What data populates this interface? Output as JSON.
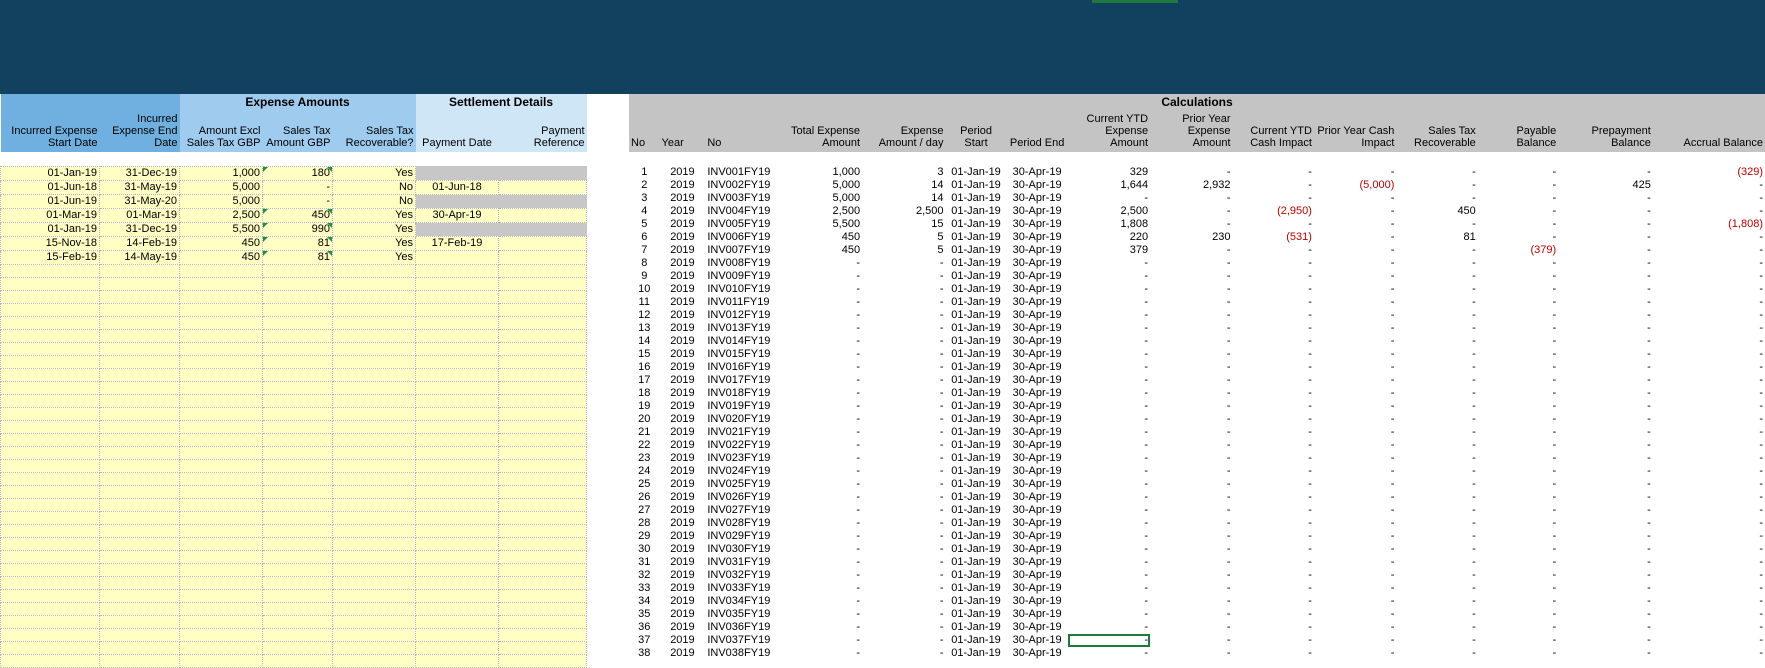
{
  "left_table": {
    "groups": {
      "expense_amounts": "Expense Amounts",
      "settlement_details": "Settlement Details"
    },
    "headers": [
      "Incurred Expense Start Date",
      "Incurred Expense End Date",
      "Amount Excl Sales Tax GBP",
      "Sales Tax Amount GBP",
      "Sales Tax Recoverable?",
      "Payment Date",
      "Payment Reference"
    ],
    "rows": [
      [
        "01-Jan-19",
        "31-Dec-19",
        "1,000",
        "180",
        "Yes",
        "",
        ""
      ],
      [
        "01-Jun-18",
        "31-May-19",
        "5,000",
        "-",
        "No",
        "01-Jun-18",
        ""
      ],
      [
        "01-Jun-19",
        "31-May-20",
        "5,000",
        "-",
        "No",
        "",
        ""
      ],
      [
        "01-Mar-19",
        "01-Mar-19",
        "2,500",
        "450",
        "Yes",
        "30-Apr-19",
        ""
      ],
      [
        "01-Jan-19",
        "31-Dec-19",
        "5,500",
        "990",
        "Yes",
        "",
        ""
      ],
      [
        "15-Nov-18",
        "14-Feb-19",
        "450",
        "81",
        "Yes",
        "17-Feb-19",
        ""
      ],
      [
        "15-Feb-19",
        "14-May-19",
        "450",
        "81",
        "Yes",
        "",
        ""
      ]
    ],
    "blank_rows": 31
  },
  "right_table": {
    "group": "Calculations",
    "headers": [
      "No",
      "Year",
      "No",
      "Total Expense Amount",
      "Expense Amount / day",
      "Period Start",
      "Period End",
      "Current YTD Expense Amount",
      "Prior Year Expense Amount",
      "Current YTD Cash Impact",
      "Prior Year Cash Impact",
      "Sales Tax Recoverable",
      "Payable Balance",
      "Prepayment Balance",
      "Accrual Balance"
    ],
    "rows": [
      [
        "1",
        "2019",
        "INV001FY19",
        "1,000",
        "3",
        "01-Jan-19",
        "30-Apr-19",
        "329",
        "-",
        "-",
        "-",
        "-",
        "-",
        "-",
        "(329)"
      ],
      [
        "2",
        "2019",
        "INV002FY19",
        "5,000",
        "14",
        "01-Jan-19",
        "30-Apr-19",
        "1,644",
        "2,932",
        "-",
        "(5,000)",
        "-",
        "-",
        "425",
        "-"
      ],
      [
        "3",
        "2019",
        "INV003FY19",
        "5,000",
        "14",
        "01-Jan-19",
        "30-Apr-19",
        "-",
        "-",
        "-",
        "-",
        "-",
        "-",
        "-",
        "-"
      ],
      [
        "4",
        "2019",
        "INV004FY19",
        "2,500",
        "2,500",
        "01-Jan-19",
        "30-Apr-19",
        "2,500",
        "-",
        "(2,950)",
        "-",
        "450",
        "-",
        "-",
        "-"
      ],
      [
        "5",
        "2019",
        "INV005FY19",
        "5,500",
        "15",
        "01-Jan-19",
        "30-Apr-19",
        "1,808",
        "-",
        "-",
        "-",
        "-",
        "-",
        "-",
        "(1,808)"
      ],
      [
        "6",
        "2019",
        "INV006FY19",
        "450",
        "5",
        "01-Jan-19",
        "30-Apr-19",
        "220",
        "230",
        "(531)",
        "-",
        "81",
        "-",
        "-",
        "-"
      ],
      [
        "7",
        "2019",
        "INV007FY19",
        "450",
        "5",
        "01-Jan-19",
        "30-Apr-19",
        "379",
        "-",
        "-",
        "-",
        "-",
        "(379)",
        "-",
        "-"
      ],
      [
        "8",
        "2019",
        "INV008FY19",
        "-",
        "-",
        "01-Jan-19",
        "30-Apr-19",
        "-",
        "-",
        "-",
        "-",
        "-",
        "-",
        "-",
        "-"
      ],
      [
        "9",
        "2019",
        "INV009FY19",
        "-",
        "-",
        "01-Jan-19",
        "30-Apr-19",
        "-",
        "-",
        "-",
        "-",
        "-",
        "-",
        "-",
        "-"
      ],
      [
        "10",
        "2019",
        "INV010FY19",
        "-",
        "-",
        "01-Jan-19",
        "30-Apr-19",
        "-",
        "-",
        "-",
        "-",
        "-",
        "-",
        "-",
        "-"
      ],
      [
        "11",
        "2019",
        "INV011FY19",
        "-",
        "-",
        "01-Jan-19",
        "30-Apr-19",
        "-",
        "-",
        "-",
        "-",
        "-",
        "-",
        "-",
        "-"
      ],
      [
        "12",
        "2019",
        "INV012FY19",
        "-",
        "-",
        "01-Jan-19",
        "30-Apr-19",
        "-",
        "-",
        "-",
        "-",
        "-",
        "-",
        "-",
        "-"
      ],
      [
        "13",
        "2019",
        "INV013FY19",
        "-",
        "-",
        "01-Jan-19",
        "30-Apr-19",
        "-",
        "-",
        "-",
        "-",
        "-",
        "-",
        "-",
        "-"
      ],
      [
        "14",
        "2019",
        "INV014FY19",
        "-",
        "-",
        "01-Jan-19",
        "30-Apr-19",
        "-",
        "-",
        "-",
        "-",
        "-",
        "-",
        "-",
        "-"
      ],
      [
        "15",
        "2019",
        "INV015FY19",
        "-",
        "-",
        "01-Jan-19",
        "30-Apr-19",
        "-",
        "-",
        "-",
        "-",
        "-",
        "-",
        "-",
        "-"
      ],
      [
        "16",
        "2019",
        "INV016FY19",
        "-",
        "-",
        "01-Jan-19",
        "30-Apr-19",
        "-",
        "-",
        "-",
        "-",
        "-",
        "-",
        "-",
        "-"
      ],
      [
        "17",
        "2019",
        "INV017FY19",
        "-",
        "-",
        "01-Jan-19",
        "30-Apr-19",
        "-",
        "-",
        "-",
        "-",
        "-",
        "-",
        "-",
        "-"
      ],
      [
        "18",
        "2019",
        "INV018FY19",
        "-",
        "-",
        "01-Jan-19",
        "30-Apr-19",
        "-",
        "-",
        "-",
        "-",
        "-",
        "-",
        "-",
        "-"
      ],
      [
        "19",
        "2019",
        "INV019FY19",
        "-",
        "-",
        "01-Jan-19",
        "30-Apr-19",
        "-",
        "-",
        "-",
        "-",
        "-",
        "-",
        "-",
        "-"
      ],
      [
        "20",
        "2019",
        "INV020FY19",
        "-",
        "-",
        "01-Jan-19",
        "30-Apr-19",
        "-",
        "-",
        "-",
        "-",
        "-",
        "-",
        "-",
        "-"
      ],
      [
        "21",
        "2019",
        "INV021FY19",
        "-",
        "-",
        "01-Jan-19",
        "30-Apr-19",
        "-",
        "-",
        "-",
        "-",
        "-",
        "-",
        "-",
        "-"
      ],
      [
        "22",
        "2019",
        "INV022FY19",
        "-",
        "-",
        "01-Jan-19",
        "30-Apr-19",
        "-",
        "-",
        "-",
        "-",
        "-",
        "-",
        "-",
        "-"
      ],
      [
        "23",
        "2019",
        "INV023FY19",
        "-",
        "-",
        "01-Jan-19",
        "30-Apr-19",
        "-",
        "-",
        "-",
        "-",
        "-",
        "-",
        "-",
        "-"
      ],
      [
        "24",
        "2019",
        "INV024FY19",
        "-",
        "-",
        "01-Jan-19",
        "30-Apr-19",
        "-",
        "-",
        "-",
        "-",
        "-",
        "-",
        "-",
        "-"
      ],
      [
        "25",
        "2019",
        "INV025FY19",
        "-",
        "-",
        "01-Jan-19",
        "30-Apr-19",
        "-",
        "-",
        "-",
        "-",
        "-",
        "-",
        "-",
        "-"
      ],
      [
        "26",
        "2019",
        "INV026FY19",
        "-",
        "-",
        "01-Jan-19",
        "30-Apr-19",
        "-",
        "-",
        "-",
        "-",
        "-",
        "-",
        "-",
        "-"
      ],
      [
        "27",
        "2019",
        "INV027FY19",
        "-",
        "-",
        "01-Jan-19",
        "30-Apr-19",
        "-",
        "-",
        "-",
        "-",
        "-",
        "-",
        "-",
        "-"
      ],
      [
        "28",
        "2019",
        "INV028FY19",
        "-",
        "-",
        "01-Jan-19",
        "30-Apr-19",
        "-",
        "-",
        "-",
        "-",
        "-",
        "-",
        "-",
        "-"
      ],
      [
        "29",
        "2019",
        "INV029FY19",
        "-",
        "-",
        "01-Jan-19",
        "30-Apr-19",
        "-",
        "-",
        "-",
        "-",
        "-",
        "-",
        "-",
        "-"
      ],
      [
        "30",
        "2019",
        "INV030FY19",
        "-",
        "-",
        "01-Jan-19",
        "30-Apr-19",
        "-",
        "-",
        "-",
        "-",
        "-",
        "-",
        "-",
        "-"
      ],
      [
        "31",
        "2019",
        "INV031FY19",
        "-",
        "-",
        "01-Jan-19",
        "30-Apr-19",
        "-",
        "-",
        "-",
        "-",
        "-",
        "-",
        "-",
        "-"
      ],
      [
        "32",
        "2019",
        "INV032FY19",
        "-",
        "-",
        "01-Jan-19",
        "30-Apr-19",
        "-",
        "-",
        "-",
        "-",
        "-",
        "-",
        "-",
        "-"
      ],
      [
        "33",
        "2019",
        "INV033FY19",
        "-",
        "-",
        "01-Jan-19",
        "30-Apr-19",
        "-",
        "-",
        "-",
        "-",
        "-",
        "-",
        "-",
        "-"
      ],
      [
        "34",
        "2019",
        "INV034FY19",
        "-",
        "-",
        "01-Jan-19",
        "30-Apr-19",
        "-",
        "-",
        "-",
        "-",
        "-",
        "-",
        "-",
        "-"
      ],
      [
        "35",
        "2019",
        "INV035FY19",
        "-",
        "-",
        "01-Jan-19",
        "30-Apr-19",
        "-",
        "-",
        "-",
        "-",
        "-",
        "-",
        "-",
        "-"
      ],
      [
        "36",
        "2019",
        "INV036FY19",
        "-",
        "-",
        "01-Jan-19",
        "30-Apr-19",
        "-",
        "-",
        "-",
        "-",
        "-",
        "-",
        "-",
        "-"
      ],
      [
        "37",
        "2019",
        "INV037FY19",
        "-",
        "-",
        "01-Jan-19",
        "30-Apr-19",
        "-",
        "-",
        "-",
        "-",
        "-",
        "-",
        "-",
        "-"
      ],
      [
        "38",
        "2019",
        "INV038FY19",
        "-",
        "-",
        "01-Jan-19",
        "30-Apr-19",
        "-",
        "-",
        "-",
        "-",
        "-",
        "-",
        "-",
        "-"
      ]
    ]
  },
  "colors": {
    "banner": "#12405f",
    "header_blue_dark": "#6fb0e0",
    "header_blue_mid": "#9fcbef",
    "header_blue_light": "#cfe6f7",
    "input_yellow": "#ffffc4",
    "calc_header_gray": "#c4c4c4",
    "negative_red": "#c00000",
    "selection_green": "#1e7a3c"
  }
}
